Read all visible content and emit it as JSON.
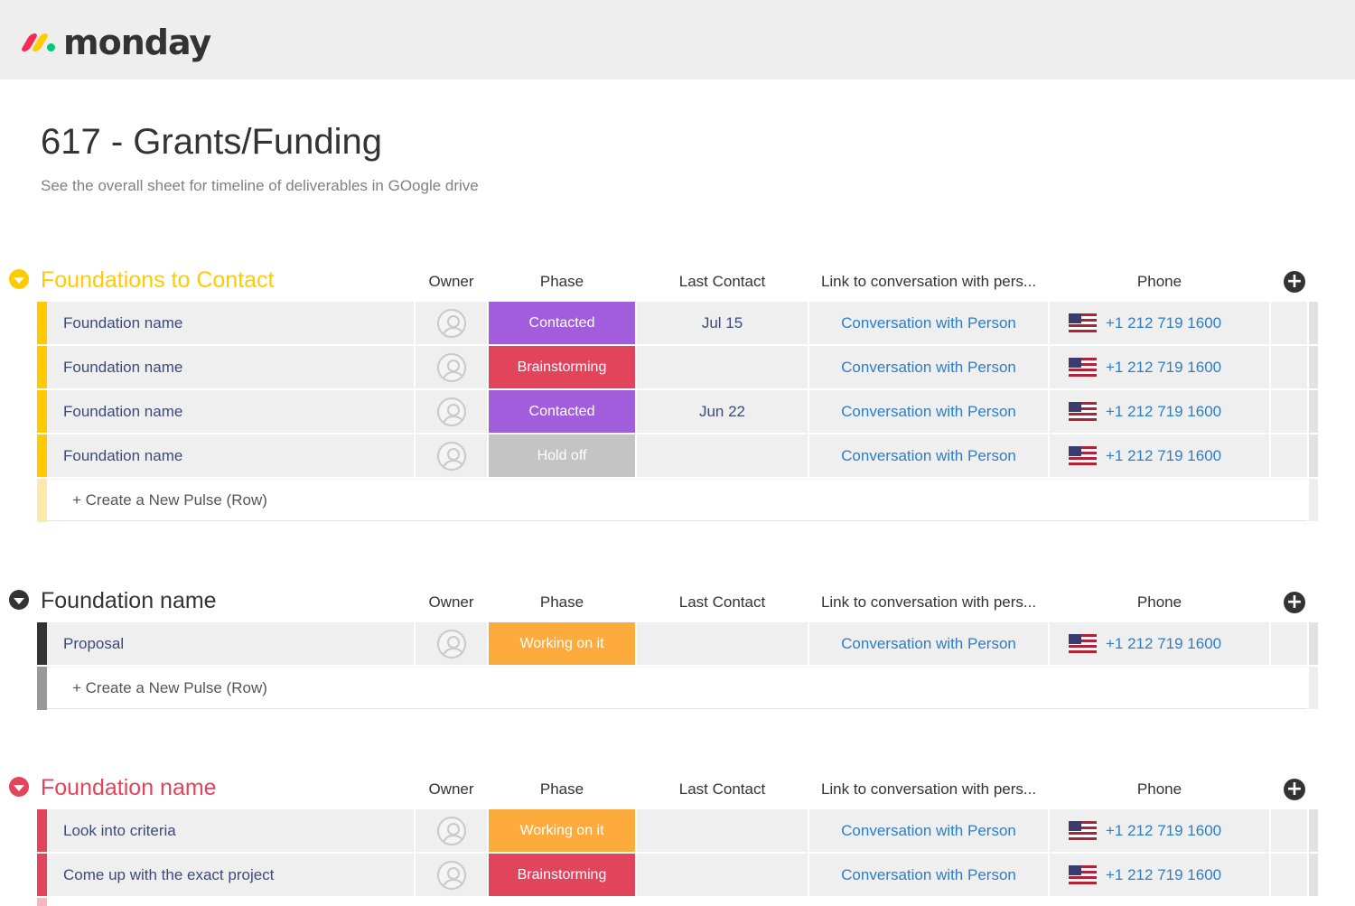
{
  "app": {
    "logo_text": "monday",
    "logo_colors": [
      "#f62b54",
      "#ffcc00",
      "#00ca72"
    ]
  },
  "board": {
    "title": "617 - Grants/Funding",
    "description": "See the overall sheet for timeline of deliverables in GOogle drive"
  },
  "columns": {
    "owner": "Owner",
    "phase": "Phase",
    "last_contact": "Last Contact",
    "link": "Link to conversation with pers...",
    "phone": "Phone"
  },
  "new_row_label": "+ Create a New Pulse (Row)",
  "status_colors": {
    "Contacted": "#a25ddc",
    "Brainstorming": "#e2445c",
    "Hold off": "#c4c4c4",
    "Working on it": "#fdab3d"
  },
  "groups": [
    {
      "title": "Foundations to Contact",
      "color": "#ffcb00",
      "light_color": "#fde9ac",
      "rows": [
        {
          "name": "Foundation name",
          "phase": "Contacted",
          "last_contact": "Jul 15",
          "link": "Conversation with Person",
          "phone": "+1 212 719 1600"
        },
        {
          "name": "Foundation name",
          "phase": "Brainstorming",
          "last_contact": "",
          "link": "Conversation with Person",
          "phone": "+1 212 719 1600"
        },
        {
          "name": "Foundation name",
          "phase": "Contacted",
          "last_contact": "Jun 22",
          "link": "Conversation with Person",
          "phone": "+1 212 719 1600"
        },
        {
          "name": "Foundation name",
          "phase": "Hold off",
          "last_contact": "",
          "link": "Conversation with Person",
          "phone": "+1 212 719 1600"
        }
      ]
    },
    {
      "title": "Foundation name",
      "color": "#333333",
      "light_color": "#999999",
      "rows": [
        {
          "name": "Proposal",
          "phase": "Working on it",
          "last_contact": "",
          "link": "Conversation with Person",
          "phone": "+1 212 719 1600"
        }
      ]
    },
    {
      "title": "Foundation name",
      "color": "#e2445c",
      "light_color": "#f4b6bf",
      "rows": [
        {
          "name": "Look into criteria",
          "phase": "Working on it",
          "last_contact": "",
          "link": "Conversation with Person",
          "phone": "+1 212 719 1600"
        },
        {
          "name": "Come up with the exact project",
          "phase": "Brainstorming",
          "last_contact": "",
          "link": "Conversation with Person",
          "phone": "+1 212 719 1600"
        }
      ]
    }
  ]
}
